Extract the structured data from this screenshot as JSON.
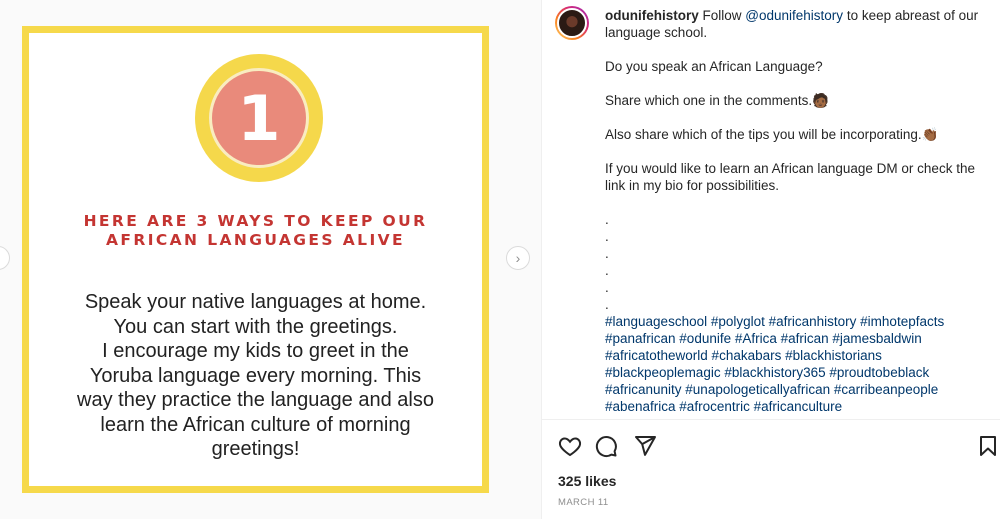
{
  "image": {
    "badge_number": "1",
    "heading_line1": "HERE ARE 3 WAYS TO KEEP OUR",
    "heading_line2": "AFRICAN LANGUAGES ALIVE",
    "body_lines": [
      "Speak your native languages at home.",
      "You can start with the greetings.",
      "I encourage my kids to greet in the",
      "Yoruba language every morning. This",
      "way they practice the language and also",
      "learn the African culture of morning",
      "greetings!"
    ],
    "colors": {
      "frame": "#f6d94b",
      "badge": "#e98a7b",
      "heading": "#c43532"
    }
  },
  "nav": {
    "next_icon": "chevron-right-icon"
  },
  "post": {
    "username": "odunifehistory",
    "caption_intro": "Follow",
    "mention": "@odunifehistory",
    "caption_line1_rest": "to keep abreast of our language school.",
    "question": "Do you speak an African Language?",
    "share_line": "Share which one in the comments.",
    "tips_line": "Also share which of the tips you will be incorporating.",
    "learn_line": "If you would like to learn an African language DM or check the link in my bio for possibilities.",
    "dots": [
      ".",
      ".",
      ".",
      ".",
      ".",
      "."
    ],
    "hashtags": "#languageschool #polyglot #africanhistory #imhotepfacts #panafrican #odunife #Africa #african #jamesbaldwin #africatotheworld #chakabars #blackhistorians #blackpeoplemagic #blackhistory365 #proudtobeblack #africanunity #unapologeticallyafrican #carribeanpeople #abenafrica #afrocentric #africanculture",
    "likes": "325 likes",
    "date": "MARCH 11"
  }
}
